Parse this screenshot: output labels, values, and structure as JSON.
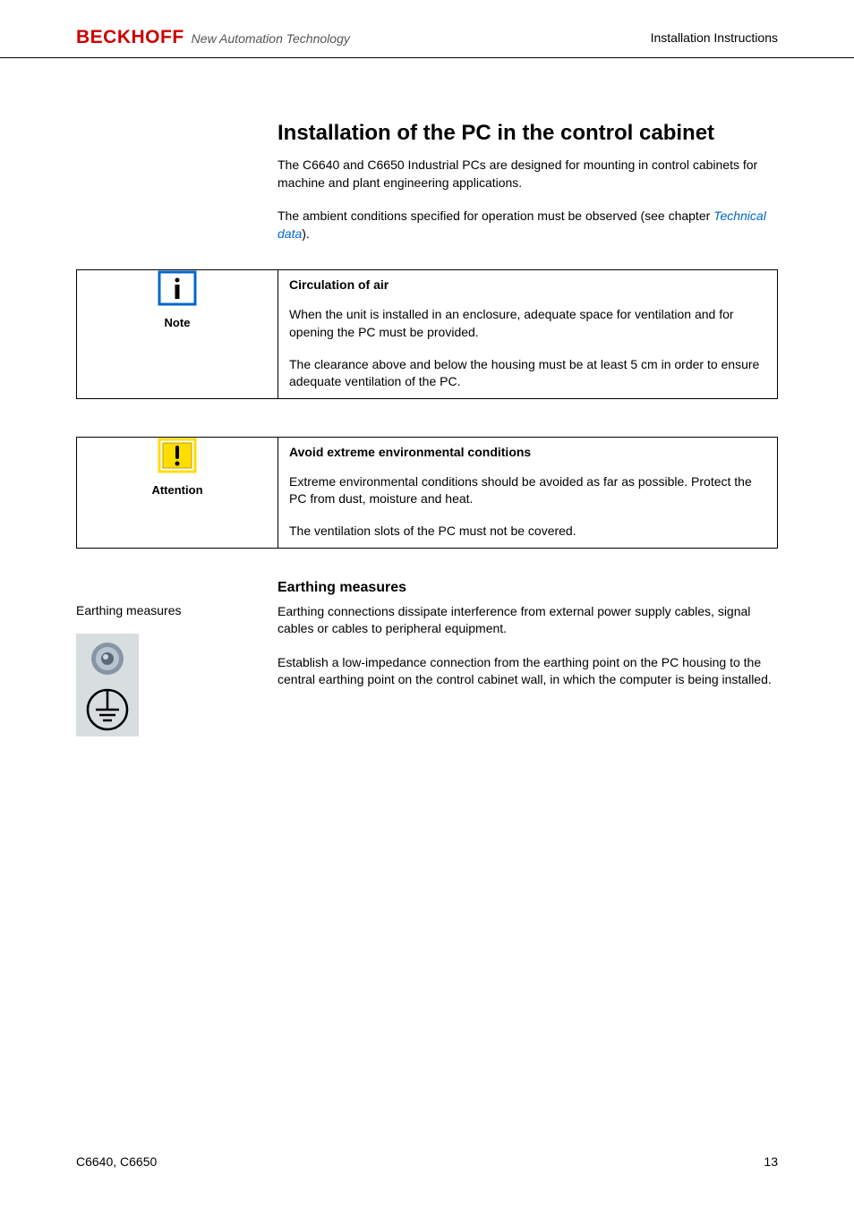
{
  "header": {
    "logo_main": "BECKHOFF",
    "logo_tagline": "New Automation Technology",
    "right_text": "Installation Instructions"
  },
  "main": {
    "heading": "Installation of the PC in the control cabinet",
    "intro1": "The C6640 and C6650 Industrial PCs are designed for mounting in control cabinets for machine and plant engineering applications.",
    "intro2_prefix": "The ambient conditions specified for operation must be observed (see chapter ",
    "intro2_link": "Technical data",
    "intro2_suffix": ")."
  },
  "note_box": {
    "icon_name": "note-icon",
    "label": "Note",
    "title": "Circulation of air",
    "row1": "When the unit is installed in an enclosure, adequate space for ventilation and for opening the PC must be provided.",
    "row2": "The clearance above and below the housing must be at least 5 cm in order to ensure adequate ventilation of the PC."
  },
  "attention_box": {
    "icon_name": "attention-icon",
    "label": "Attention",
    "title": "Avoid extreme environmental conditions",
    "row1": "Extreme environmental conditions should be avoided as far as possible. Protect the PC from dust, moisture and heat.",
    "row2": "The ventilation slots of the PC must not be covered."
  },
  "earthing": {
    "heading": "Earthing measures",
    "side_label": "Earthing measures",
    "para1": "Earthing connections dissipate interference from external power supply cables, signal cables or cables to peripheral equipment.",
    "para2": "Establish a low-impedance connection from the earthing point on the PC housing to the central earthing point on the control cabinet wall, in which the computer is being installed."
  },
  "footer": {
    "left": "C6640, C6650",
    "right": "13"
  }
}
